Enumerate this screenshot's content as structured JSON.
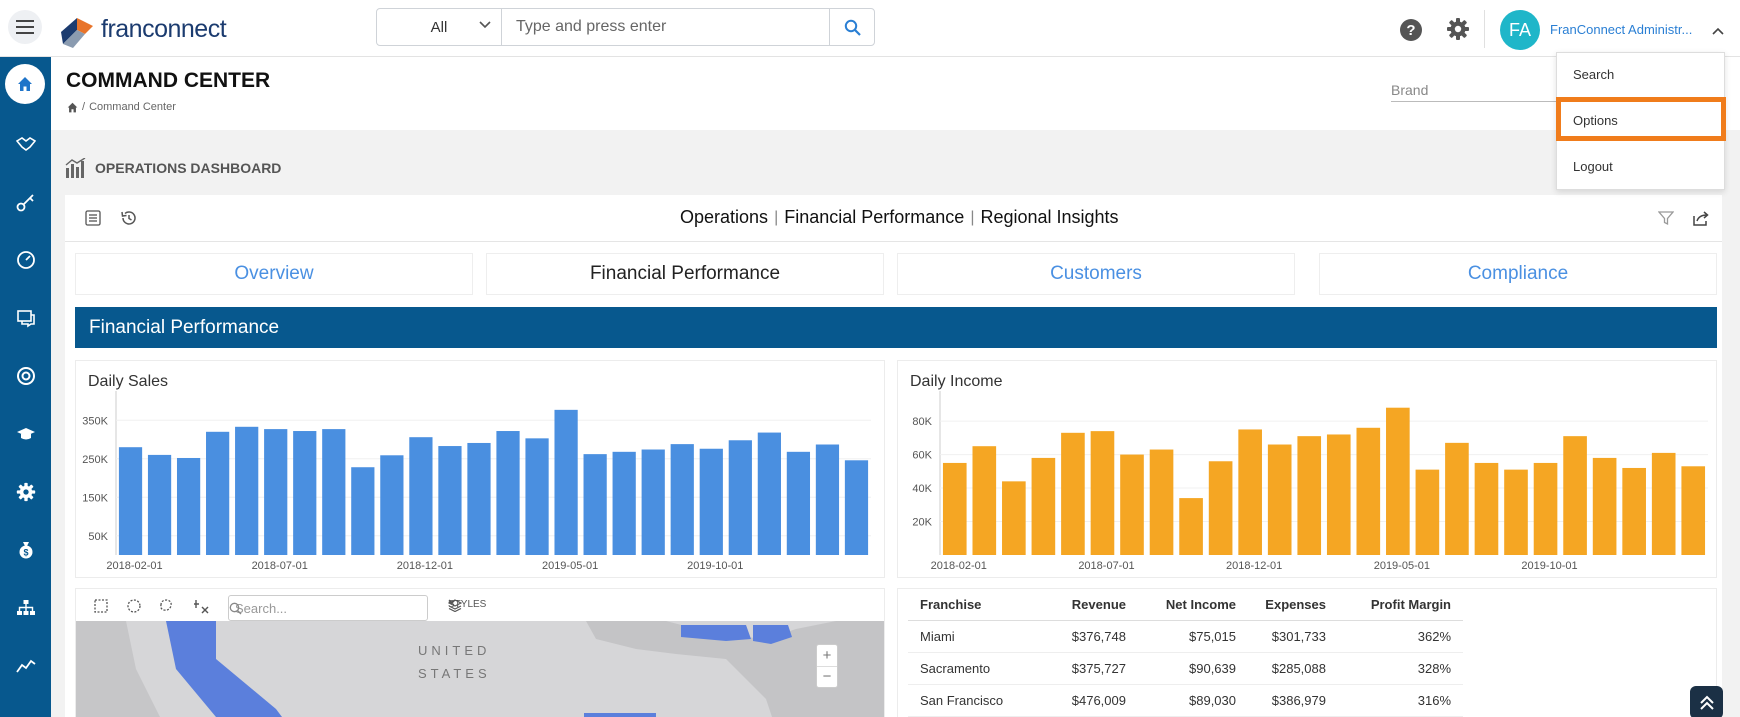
{
  "app": {
    "brand": "franconnect"
  },
  "search": {
    "scope": "All",
    "placeholder": "Type and press enter"
  },
  "user": {
    "initials": "FA",
    "name": "FranConnect Administr..."
  },
  "user_menu": {
    "items": [
      "Search",
      "Options",
      "Logout"
    ]
  },
  "page": {
    "title": "COMMAND CENTER",
    "breadcrumb": "Command Center",
    "brand_label": "Brand"
  },
  "dashboard": {
    "title": "OPERATIONS DASHBOARD"
  },
  "nav_tabs": [
    "Operations",
    "Financial Performance",
    "Regional Insights"
  ],
  "tabs": [
    "Overview",
    "Financial Performance",
    "Customers",
    "Compliance"
  ],
  "section": {
    "title": "Financial Performance"
  },
  "daily_sales": {
    "title": "Daily Sales",
    "color": "#4a8fe0",
    "yticks": [
      "350K",
      "250K",
      "150K",
      "50K"
    ],
    "xticks": [
      "2018-02-01",
      "2018-07-01",
      "2018-12-01",
      "2019-05-01",
      "2019-10-01"
    ]
  },
  "daily_income": {
    "title": "Daily Income",
    "color": "#f5a623",
    "yticks": [
      "80K",
      "60K",
      "40K",
      "20K"
    ],
    "xticks": [
      "2018-02-01",
      "2018-07-01",
      "2018-12-01",
      "2019-05-01",
      "2019-10-01"
    ]
  },
  "chart_data": [
    {
      "type": "bar",
      "title": "Daily Sales",
      "xlabel": "",
      "ylabel": "",
      "ylim": [
        0,
        400000
      ],
      "yticks": [
        50000,
        150000,
        250000,
        350000
      ],
      "values": [
        280000,
        260000,
        252000,
        320000,
        333000,
        327000,
        322000,
        327000,
        228000,
        259000,
        306000,
        283000,
        291000,
        322000,
        303000,
        377000,
        262000,
        268000,
        274000,
        288000,
        276000,
        298000,
        318000,
        268000,
        287000,
        246000
      ]
    },
    {
      "type": "bar",
      "title": "Daily Income",
      "xlabel": "",
      "ylabel": "",
      "ylim": [
        0,
        92000
      ],
      "yticks": [
        20000,
        40000,
        60000,
        80000
      ],
      "values": [
        55000,
        65000,
        44000,
        58000,
        73000,
        74000,
        60000,
        63000,
        34000,
        56000,
        75000,
        66000,
        71000,
        72000,
        76000,
        88000,
        51000,
        67000,
        55000,
        51000,
        55000,
        71000,
        58000,
        52000,
        61000,
        53000
      ]
    }
  ],
  "map": {
    "search_placeholder": "Search...",
    "styles_label": "STYLES",
    "country_label_1": "UNITED",
    "country_label_2": "STATES",
    "zoom_in": "+",
    "zoom_out": "−"
  },
  "table": {
    "headers": [
      "Franchise",
      "Revenue",
      "Net Income",
      "Expenses",
      "Profit Margin"
    ],
    "rows": [
      [
        "Miami",
        "$376,748",
        "$75,015",
        "$301,733",
        "362%"
      ],
      [
        "Sacramento",
        "$375,727",
        "$90,639",
        "$285,088",
        "328%"
      ],
      [
        "San Francisco",
        "$476,009",
        "$89,030",
        "$386,979",
        "316%"
      ]
    ]
  }
}
